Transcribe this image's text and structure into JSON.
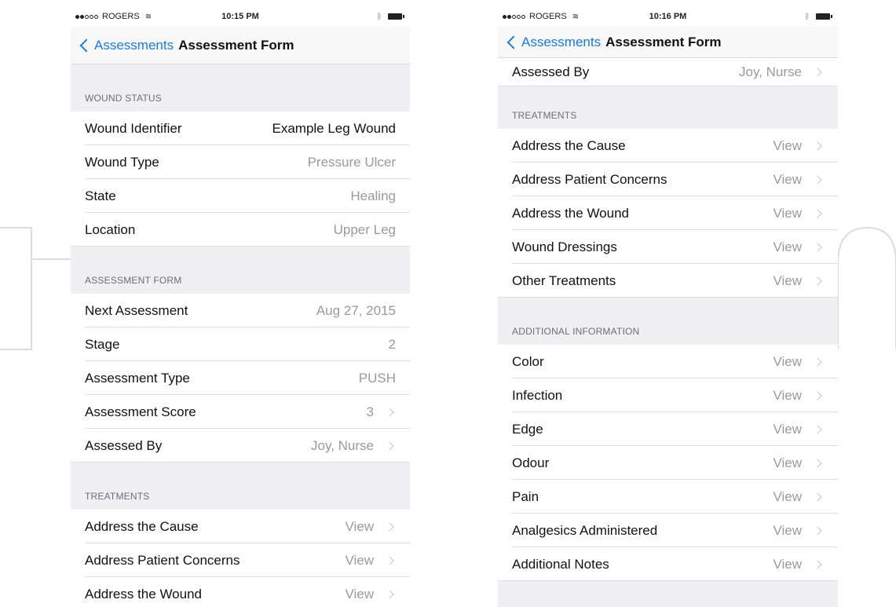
{
  "left": {
    "status": {
      "carrier": "ROGERS",
      "time": "10:15 PM"
    },
    "nav": {
      "back": "Assessments",
      "title": "Assessment Form"
    },
    "sections": {
      "wound_status": {
        "header": "WOUND STATUS",
        "rows": [
          {
            "label": "Wound Identifier",
            "value": "Example Leg Wound"
          },
          {
            "label": "Wound Type",
            "value": "Pressure Ulcer"
          },
          {
            "label": "State",
            "value": "Healing"
          },
          {
            "label": "Location",
            "value": "Upper Leg"
          }
        ]
      },
      "assessment_form": {
        "header": "ASSESSMENT FORM",
        "rows": [
          {
            "label": "Next Assessment",
            "value": "Aug 27, 2015"
          },
          {
            "label": "Stage",
            "value": "2"
          },
          {
            "label": "Assessment Type",
            "value": "PUSH"
          },
          {
            "label": "Assessment Score",
            "value": "3"
          },
          {
            "label": "Assessed By",
            "value": "Joy, Nurse"
          }
        ]
      },
      "treatments": {
        "header": "TREATMENTS",
        "rows": [
          {
            "label": "Address the Cause",
            "value": "View"
          },
          {
            "label": "Address Patient Concerns",
            "value": "View"
          },
          {
            "label": "Address the Wound",
            "value": "View"
          }
        ]
      }
    }
  },
  "right": {
    "status": {
      "carrier": "ROGERS",
      "time": "10:16 PM"
    },
    "nav": {
      "back": "Assessments",
      "title": "Assessment Form"
    },
    "top_row": {
      "label": "Assessed By",
      "value": "Joy, Nurse"
    },
    "sections": {
      "treatments": {
        "header": "TREATMENTS",
        "rows": [
          {
            "label": "Address the Cause",
            "value": "View"
          },
          {
            "label": "Address Patient Concerns",
            "value": "View"
          },
          {
            "label": "Address the Wound",
            "value": "View"
          },
          {
            "label": "Wound Dressings",
            "value": "View"
          },
          {
            "label": "Other Treatments",
            "value": "View"
          }
        ]
      },
      "additional_information": {
        "header": "ADDITIONAL INFORMATION",
        "rows": [
          {
            "label": "Color",
            "value": "View"
          },
          {
            "label": "Infection",
            "value": "View"
          },
          {
            "label": "Edge",
            "value": "View"
          },
          {
            "label": "Odour",
            "value": "View"
          },
          {
            "label": "Pain",
            "value": "View"
          },
          {
            "label": "Analgesics Administered",
            "value": "View"
          },
          {
            "label": "Additional Notes",
            "value": "View"
          }
        ]
      }
    }
  },
  "icons": [
    "wifi-icon",
    "bluetooth-icon",
    "battery-icon",
    "back-chevron-icon",
    "disclosure-chevron-icon"
  ],
  "colors": {
    "tint": "#1a7ae8",
    "group_background": "#efeff4",
    "secondary_text": "#9a9a9e"
  }
}
